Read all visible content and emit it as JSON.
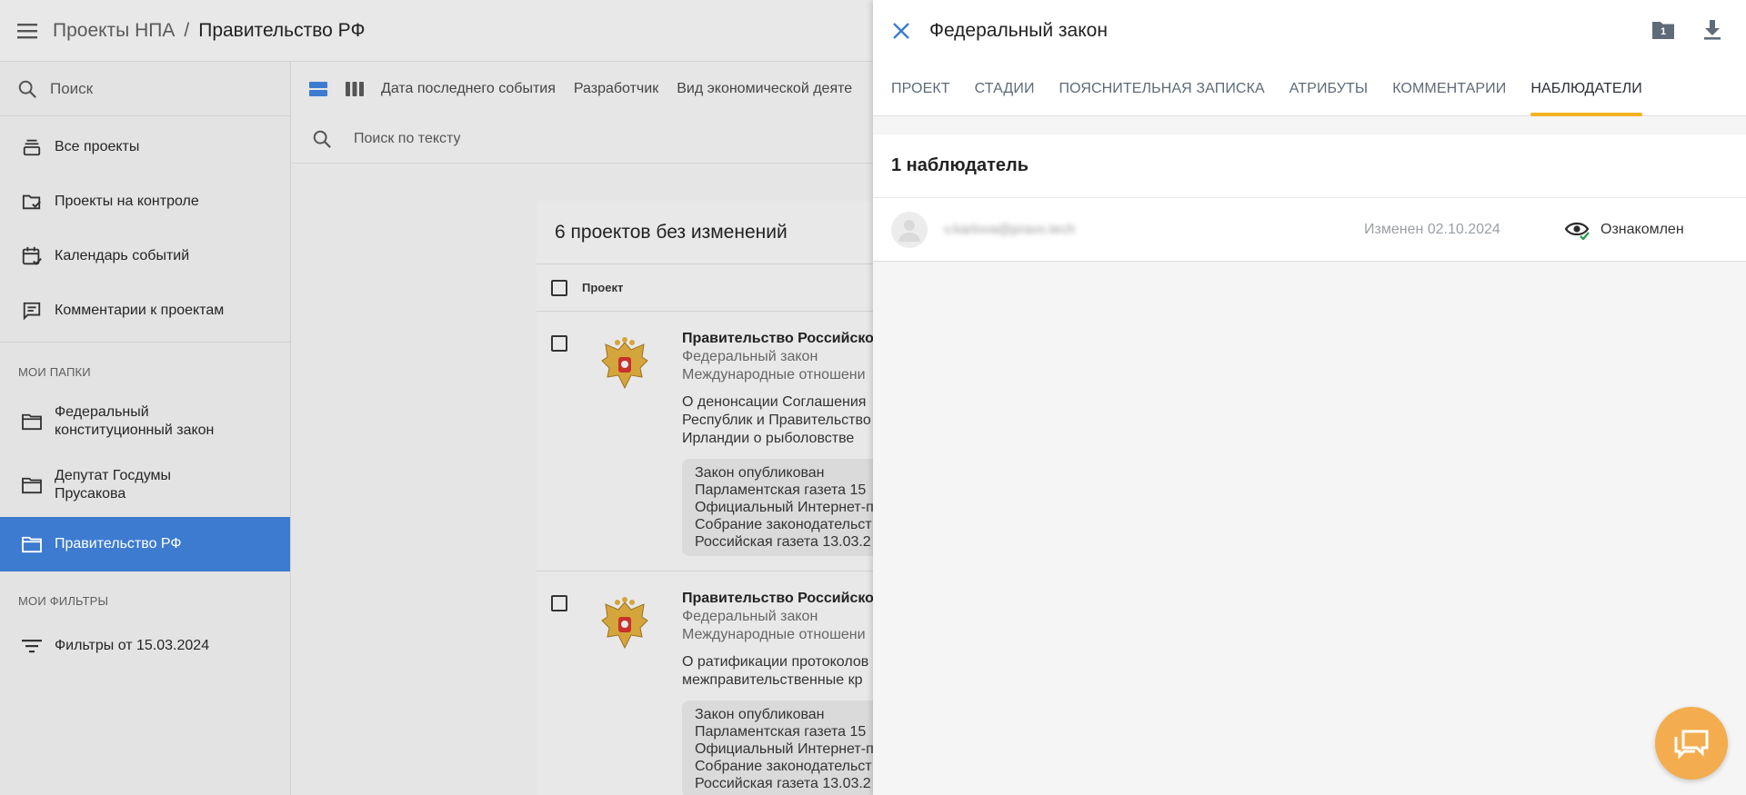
{
  "header": {
    "breadcrumb_root": "Проекты НПА",
    "breadcrumb_separator": "/",
    "breadcrumb_current": "Правительство РФ"
  },
  "sidebar": {
    "search_placeholder": "Поиск",
    "nav": [
      {
        "label": "Все проекты",
        "icon": "stack-icon"
      },
      {
        "label": "Проекты на контроле",
        "icon": "folder-check-icon"
      },
      {
        "label": "Календарь событий",
        "icon": "calendar-check-icon"
      },
      {
        "label": "Комментарии к проектам",
        "icon": "comment-icon"
      }
    ],
    "folders_title": "МОИ ПАПКИ",
    "folders": [
      {
        "label": "Федеральный конституционный закон"
      },
      {
        "label": "Депутат Госдумы Прусакова"
      },
      {
        "label": "Правительство РФ",
        "active": true
      }
    ],
    "filters_title": "МОИ ФИЛЬТРЫ",
    "filters": [
      {
        "label": "Фильтры от 15.03.2024"
      }
    ]
  },
  "toolbar": {
    "filters": [
      "Дата последнего события",
      "Разработчик",
      "Вид экономической деяте"
    ],
    "text_search_placeholder": "Поиск по тексту"
  },
  "list": {
    "heading": "6 проектов без изменений",
    "column_project": "Проект",
    "projects": [
      {
        "org": "Правительство Российской",
        "type": "Федеральный закон",
        "category": "Международные отношени",
        "desc": [
          "О денонсации Соглашения",
          "Республик и Правительство",
          "Ирландии о рыболовстве"
        ],
        "events": [
          "Закон опубликован",
          "Парламентская газета 15",
          "Официальный Интернет-п",
          "Собрание законодательст",
          "Российская газета 13.03.2"
        ]
      },
      {
        "org": "Правительство Российской",
        "type": "Федеральный закон",
        "category": "Международные отношени",
        "desc": [
          "О ратификации протоколов",
          "межправительственные кр"
        ],
        "events": [
          "Закон опубликован",
          "Парламентская газета 15",
          "Официальный Интернет-п",
          "Собрание законодательст",
          "Российская газета 13.03.2"
        ]
      }
    ]
  },
  "panel": {
    "title": "Федеральный закон",
    "folder_badge": "1",
    "tabs": [
      "ПРОЕКТ",
      "СТАДИИ",
      "ПОЯСНИТЕЛЬНАЯ ЗАПИСКА",
      "АТРИБУТЫ",
      "КОММЕНТАРИИ",
      "НАБЛЮДАТЕЛИ"
    ],
    "active_tab_index": 5,
    "observers_heading": "1 наблюдатель",
    "observer": {
      "email": "v.karlova@pravo.tech",
      "changed": "Изменен 02.10.2024",
      "status": "Ознакомлен"
    }
  },
  "colors": {
    "accent_blue": "#3d7bd0",
    "tab_underline": "#f4b323",
    "fab": "#f3ad4e",
    "status_check": "#2e9d48"
  }
}
